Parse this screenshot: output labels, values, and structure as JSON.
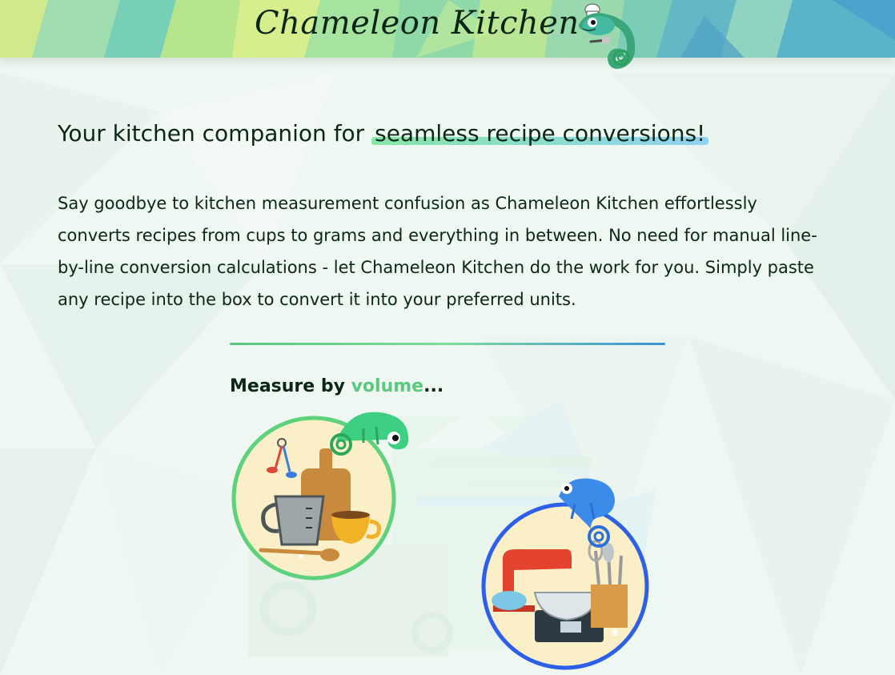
{
  "header": {
    "title": "Chameleon Kitchen",
    "logo_icon": "chameleon-chef-icon"
  },
  "main": {
    "tagline_prefix": "Your kitchen companion for ",
    "tagline_highlight": "seamless recipe conversions!",
    "intro": "Say goodbye to kitchen measurement confusion as Chameleon Kitchen effortlessly converts recipes from cups to grams and everything in between. No need for manual line-by-line conversion calculations - let Chameleon Kitchen do the work for you. Simply paste any recipe into the box to convert it into your preferred units.",
    "measure_prefix": "Measure by ",
    "measure_accent": "volume",
    "measure_suffix": "...",
    "volume_illustration": "volume-tools-illustration",
    "weight_illustration": "weight-tools-illustration"
  },
  "colors": {
    "text": "#0b2616",
    "accent_green": "#5cc77f",
    "accent_blue": "#3b8fdb",
    "volume_ring": "#5ed17b",
    "weight_ring": "#2e5fe8"
  }
}
